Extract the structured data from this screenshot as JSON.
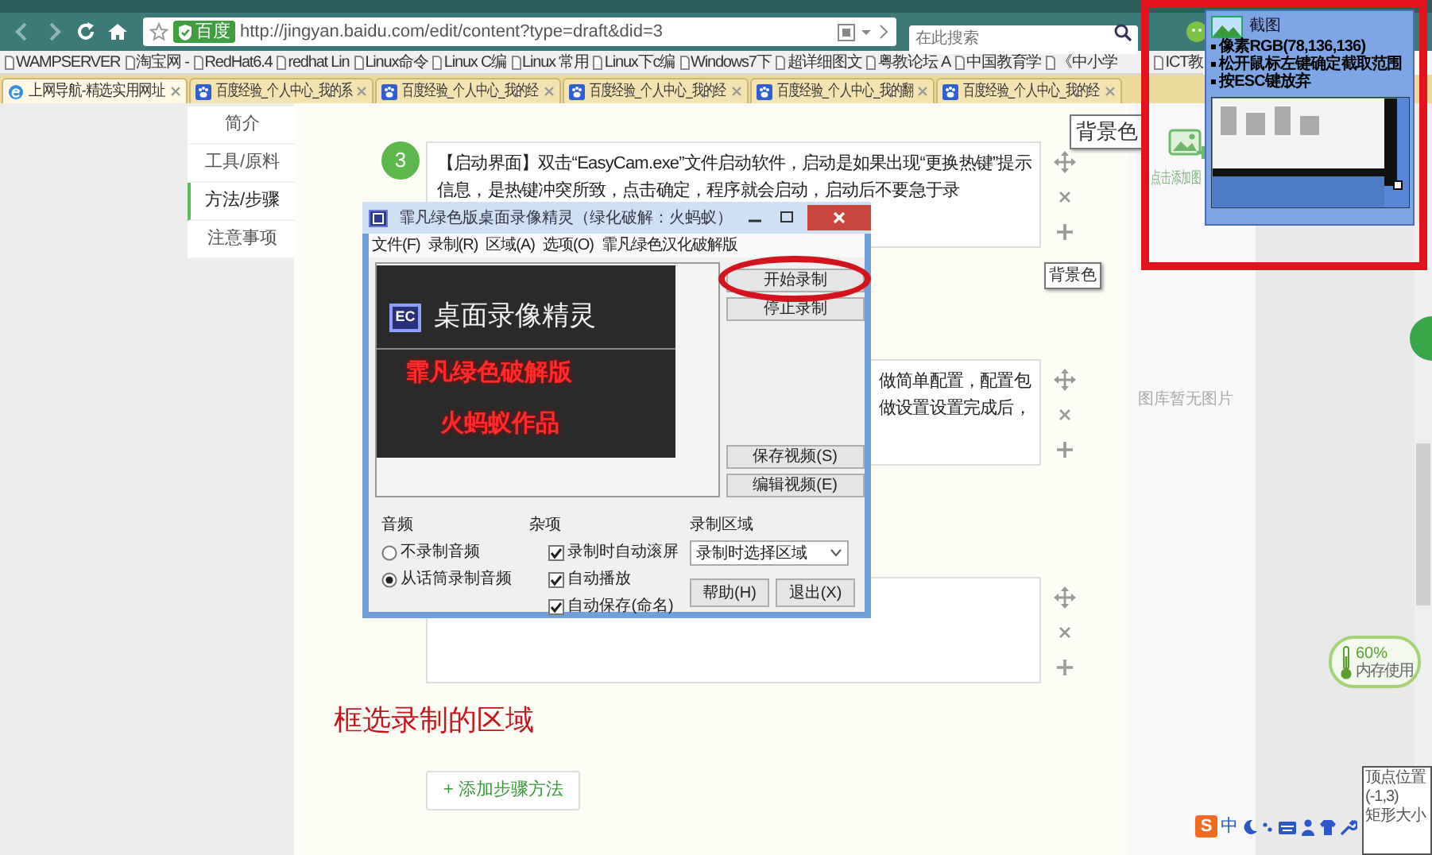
{
  "browser": {
    "url": "http://jingyan.baidu.com/edit/content?type=draft&did=3",
    "site_badge": "百度",
    "search_placeholder": "在此搜索"
  },
  "bookmarks": [
    "WAMPSERVER",
    "淘宝网 -",
    "RedHat6.4",
    "redhat Lin",
    "Linux命令",
    "Linux C编",
    "Linux 常用",
    "Linux下c编",
    "Windows7下",
    "超详细图文",
    "粤教论坛 A",
    "中国教育学",
    "《中小学",
    "ICT教"
  ],
  "tabs": [
    {
      "label": "上网导航-精选实用网址",
      "kind": "web",
      "selected": true
    },
    {
      "label": "百度经验_个人中心_我的系",
      "kind": "baidu",
      "selected": false
    },
    {
      "label": "百度经验_个人中心_我的经",
      "kind": "baidu",
      "selected": false
    },
    {
      "label": "百度经验_个人中心_我的经",
      "kind": "baidu",
      "selected": false
    },
    {
      "label": "百度经验_个人中心_我的翻",
      "kind": "baidu",
      "selected": false
    },
    {
      "label": "百度经验_个人中心_我的经",
      "kind": "baidu",
      "selected": false
    }
  ],
  "sidebar": [
    {
      "label": "简介",
      "selected": false
    },
    {
      "label": "工具/原料",
      "selected": false
    },
    {
      "label": "方法/步骤",
      "selected": true
    },
    {
      "label": "注意事项",
      "selected": false
    }
  ],
  "steps": [
    {
      "kind": "shown",
      "number": "3",
      "text": "【启动界面】双击“EasyCam.exe”文件启动软件，启动是如果出现“更换热键”提示信息，是热键冲突所致，点击确定，程序就会启动，启动后不要急于录"
    },
    {
      "kind": "covered",
      "fragments": [
        "做简单配置，配置包",
        "做设置设置完成后，"
      ]
    },
    {
      "kind": "covered"
    }
  ],
  "annotation": "框选录制的区域",
  "add_step_button": "+ 添加步骤方法",
  "tooltips": [
    "背景色",
    "背景色"
  ],
  "right_panel": {
    "add_image": "点击添加图",
    "empty": "图库暂无图片"
  },
  "recorder_window": {
    "title": "霏凡绿色版桌面录像精灵（绿化破解：火蚂蚁）",
    "menu": [
      "文件(F)",
      "录制(R)",
      "区域(A)",
      "选项(O)",
      "霏凡绿色汉化破解版"
    ],
    "splash": {
      "logo": "EC",
      "title": "桌面录像精灵",
      "lines": [
        "霏凡绿色破解版",
        "火蚂蚁作品"
      ]
    },
    "record_buttons": [
      {
        "label": "开始录制",
        "circled": true
      },
      {
        "label": "停止录制",
        "circled": false
      }
    ],
    "video_buttons": [
      "保存视频(S)",
      "编辑视频(E)"
    ],
    "audio": {
      "title": "音频",
      "options": [
        {
          "label": "不录制音频",
          "selected": false
        },
        {
          "label": "从话筒录制音频",
          "selected": true
        }
      ]
    },
    "misc": {
      "title": "杂项",
      "options": [
        {
          "label": "录制时自动滚屏",
          "checked": true
        },
        {
          "label": "自动播放",
          "checked": true
        },
        {
          "label": "自动保存(命名)",
          "checked": true
        }
      ]
    },
    "region": {
      "title": "录制区域",
      "value": "录制时选择区域"
    },
    "bottom_buttons": [
      "帮助(H)",
      "退出(X)"
    ]
  },
  "capture_tool": {
    "title": "截图",
    "hints": [
      "像素RGB(78,136,136)",
      "松开鼠标左键确定截取范围",
      "按ESC键放弃"
    ]
  },
  "memory_widget": {
    "percent": "60%",
    "label": "内存使用"
  },
  "coordinates_box": {
    "lines": [
      "顶点位置",
      "(-1,3)",
      "矩形大小"
    ]
  },
  "ime_bar": {
    "logo": "S",
    "mode": "中"
  }
}
